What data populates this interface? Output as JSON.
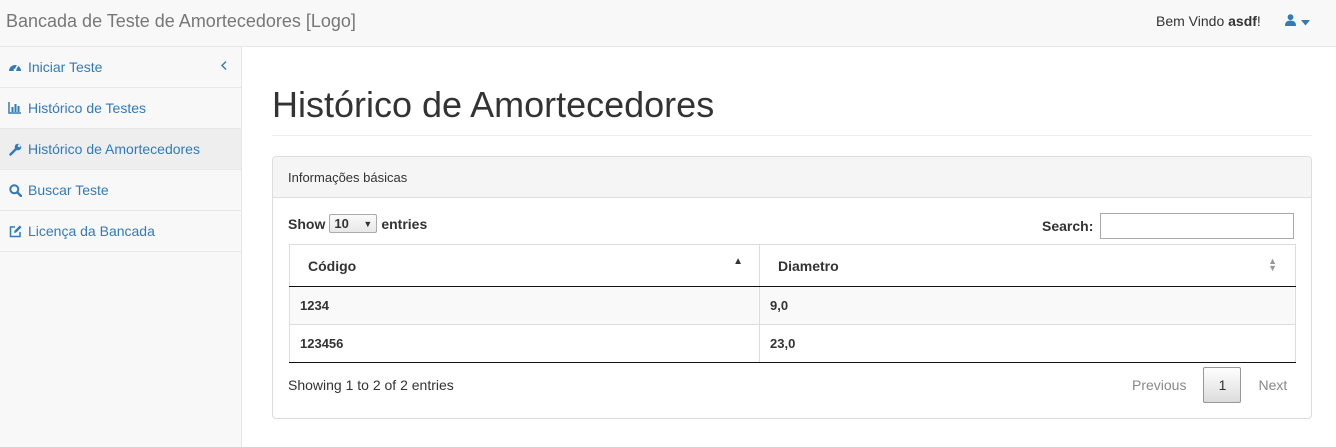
{
  "navbar": {
    "brand": "Bancada de Teste de Amortecedores [Logo]",
    "welcome_prefix": "Bem Vindo ",
    "username": "asdf",
    "welcome_suffix": "!",
    "user_icon": "user-icon",
    "caret_icon": "caret-down-icon"
  },
  "sidebar": {
    "collapse_icon": "chevron-left-icon",
    "items": [
      {
        "label": "Iniciar Teste",
        "icon": "dashboard-icon",
        "active": false
      },
      {
        "label": "Histórico de Testes",
        "icon": "bar-chart-icon",
        "active": false
      },
      {
        "label": "Histórico de Amortecedores",
        "icon": "wrench-icon",
        "active": true
      },
      {
        "label": "Buscar Teste",
        "icon": "search-icon",
        "active": false
      },
      {
        "label": "Licença da Bancada",
        "icon": "edit-icon",
        "active": false
      }
    ]
  },
  "main": {
    "title": "Histórico de Amortecedores",
    "panel_heading": "Informações básicas",
    "length": {
      "show": "Show",
      "value": "10",
      "entries": "entries"
    },
    "search": {
      "label": "Search:",
      "value": ""
    },
    "table": {
      "columns": [
        "Código",
        "Diametro"
      ],
      "sorted_column": 0,
      "sort_direction": "asc",
      "rows": [
        [
          "1234",
          "9,0"
        ],
        [
          "123456",
          "23,0"
        ]
      ]
    },
    "info": "Showing 1 to 2 of 2 entries",
    "paging": {
      "previous": "Previous",
      "current": "1",
      "next": "Next"
    }
  },
  "colors": {
    "link": "#337ab7",
    "navbar_bg": "#f8f8f8",
    "active_item_bg": "#eeeeee"
  }
}
